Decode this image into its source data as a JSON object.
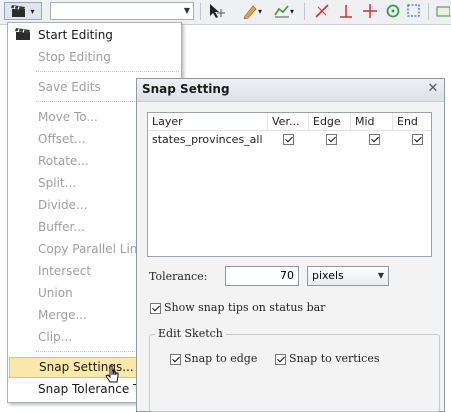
{
  "menu": {
    "items": [
      {
        "label": "Start Editing",
        "enabled": true,
        "icon": "start-editing-icon"
      },
      {
        "label": "Stop Editing",
        "enabled": false
      },
      {
        "label": "Save Edits",
        "enabled": false
      },
      {
        "label": "Move To...",
        "enabled": false
      },
      {
        "label": "Offset...",
        "enabled": false
      },
      {
        "label": "Rotate...",
        "enabled": false
      },
      {
        "label": "Split...",
        "enabled": false
      },
      {
        "label": "Divide...",
        "enabled": false
      },
      {
        "label": "Buffer...",
        "enabled": false
      },
      {
        "label": "Copy Parallel Line...",
        "enabled": false
      },
      {
        "label": "Intersect",
        "enabled": false
      },
      {
        "label": "Union",
        "enabled": false
      },
      {
        "label": "Merge...",
        "enabled": false
      },
      {
        "label": "Clip...",
        "enabled": false
      },
      {
        "label": "Snap Settings...",
        "enabled": true,
        "highlighted": true
      },
      {
        "label": "Snap Tolerance Tool",
        "enabled": true
      }
    ]
  },
  "dialog": {
    "title": "Snap Setting",
    "columns": [
      "Layer",
      "Ver...",
      "Edge",
      "Mid",
      "End"
    ],
    "rows": [
      {
        "layer": "states_provinces_all",
        "vertex": true,
        "edge": true,
        "mid": true,
        "end": true
      }
    ],
    "tolerance_label": "Tolerance:",
    "tolerance_value": "70",
    "units_value": "pixels",
    "show_tips_label": "Show snap tips on status bar",
    "show_tips_checked": true,
    "edit_sketch_label": "Edit Sketch",
    "snap_edge_label": "Snap to edge",
    "snap_vertices_label": "Snap to vertices"
  }
}
